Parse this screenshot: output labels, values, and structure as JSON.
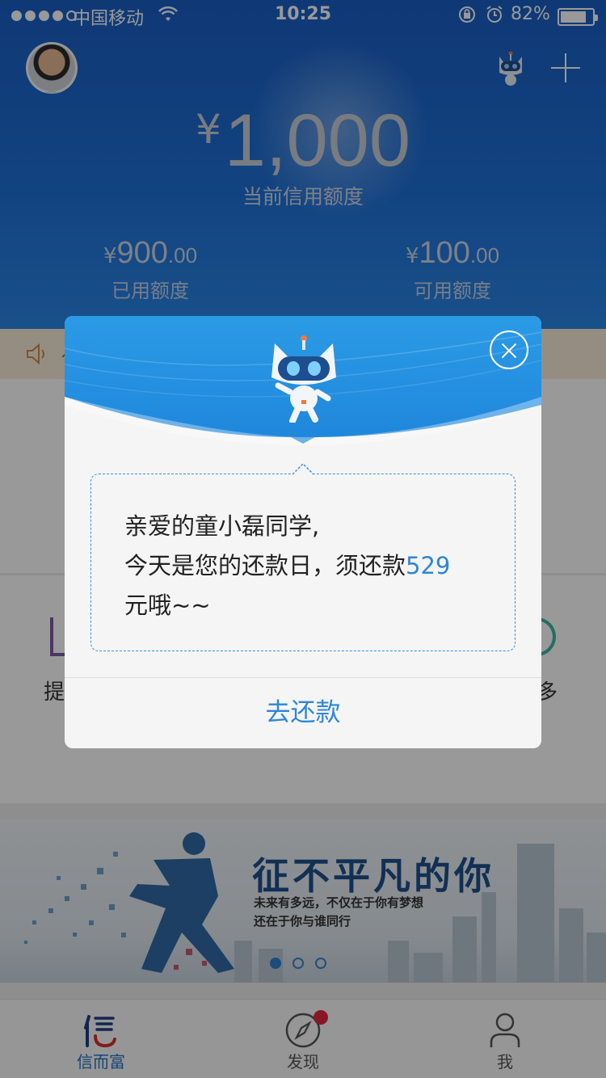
{
  "status_bar": {
    "carrier": "中国移动",
    "time": "10:25",
    "battery_percent": "82%",
    "battery_level": 0.82,
    "icons": [
      "signal-dots-icon",
      "wifi-icon",
      "rotation-lock-icon",
      "alarm-icon",
      "battery-icon"
    ]
  },
  "header": {
    "currency": "¥",
    "credit_limit": "1,000",
    "credit_limit_label": "当前信用额度",
    "used": {
      "currency": "¥",
      "integer": "900",
      "decimal": ".00",
      "label": "已用额度"
    },
    "available": {
      "currency": "¥",
      "integer": "100",
      "decimal": ".00",
      "label": "可用额度"
    },
    "icons": [
      "avatar",
      "robot-icon",
      "plus-icon"
    ]
  },
  "background": {
    "notice_text": "亻",
    "menu_left_label": "提",
    "menu_right_label": "多",
    "banner": {
      "title": "征不平凡的你",
      "line1": "未来有多远，不仅在于你有梦想",
      "line2": "还在于你与谁同行",
      "dots_count": 3,
      "active_dot": 0
    }
  },
  "dialog": {
    "greeting": "亲爱的童小磊同学,",
    "line2_prefix": "今天是您的还款日，须还款",
    "amount": "529",
    "line3": "元哦~~",
    "button_label": "去还款"
  },
  "tabbar": {
    "tabs": [
      {
        "label": "信而富",
        "icon": "xin-logo-icon",
        "active": true
      },
      {
        "label": "发现",
        "icon": "compass-icon",
        "badge": true
      },
      {
        "label": "我",
        "icon": "person-icon"
      }
    ]
  },
  "colors": {
    "header_blue": "#1e6fd6",
    "accent_blue": "#2f86d8",
    "badge_red": "#e2293b",
    "tab_active": "#2272c9"
  }
}
